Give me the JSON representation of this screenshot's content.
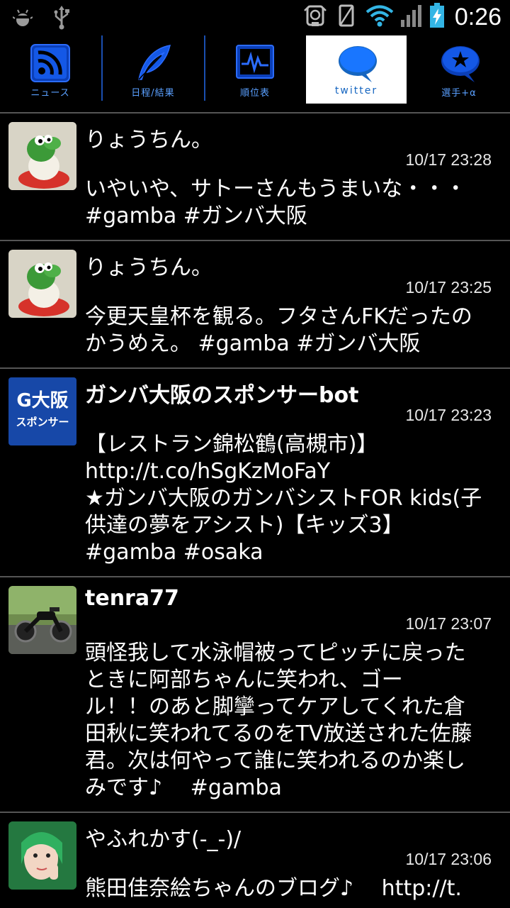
{
  "status_bar": {
    "time": "0:26",
    "icons": [
      "android-debug-icon",
      "usb-icon",
      "alarm-icon",
      "vibrate-icon",
      "wifi-icon",
      "signal-icon",
      "battery-charging-icon"
    ]
  },
  "tabs": [
    {
      "label": "ニュース",
      "icon": "rss-icon"
    },
    {
      "label": "日程/結果",
      "icon": "feather-icon"
    },
    {
      "label": "順位表",
      "icon": "chart-monitor-icon"
    },
    {
      "label": "twitter",
      "icon": "speech-bubble-icon",
      "active": true
    },
    {
      "label": "選手+α",
      "icon": "star-bubble-icon"
    }
  ],
  "tweets": [
    {
      "user": "りょうちん。",
      "time": "10/17 23:28",
      "text": "いやいや、サトーさんもうまいな・・・\n#gamba #ガンバ大阪",
      "avatar": "yoshi-plush-avatar"
    },
    {
      "user": "りょうちん。",
      "time": "10/17 23:25",
      "text": "今更天皇杯を観る。フタさんFKだったの\nかうめえ。 #gamba #ガンバ大阪",
      "avatar": "yoshi-plush-avatar"
    },
    {
      "user": "ガンバ大阪のスポンサーbot",
      "time": "10/17 23:23",
      "text": "【レストラン錦松鶴(高槻市)】\nhttp://t.co/hSgKzMoFaY\n★ガンバ大阪のガンバシストFOR kids(子\n供達の夢をアシスト)【キッズ3】\n#gamba #osaka",
      "avatar_line1": "G大阪",
      "avatar_line2": "スポンサー"
    },
    {
      "user": "tenra77",
      "time": "10/17 23:07",
      "text": "頭怪我して水泳帽被ってピッチに戻った\nときに阿部ちゃんに笑われ、ゴー\nル！！のあと脚攣ってケアしてくれた倉\n田秋に笑われてるのをTV放送された佐藤\n君。次は何やって誰に笑われるのか楽し\nみです♪　 #gamba",
      "avatar": "motorcycle-avatar"
    },
    {
      "user": "やふれかす(-_-)/",
      "time": "10/17 23:06",
      "text": "熊田佳奈絵ちゃんのブログ♪　 http://t.",
      "avatar": "girl-photo-avatar"
    }
  ]
}
